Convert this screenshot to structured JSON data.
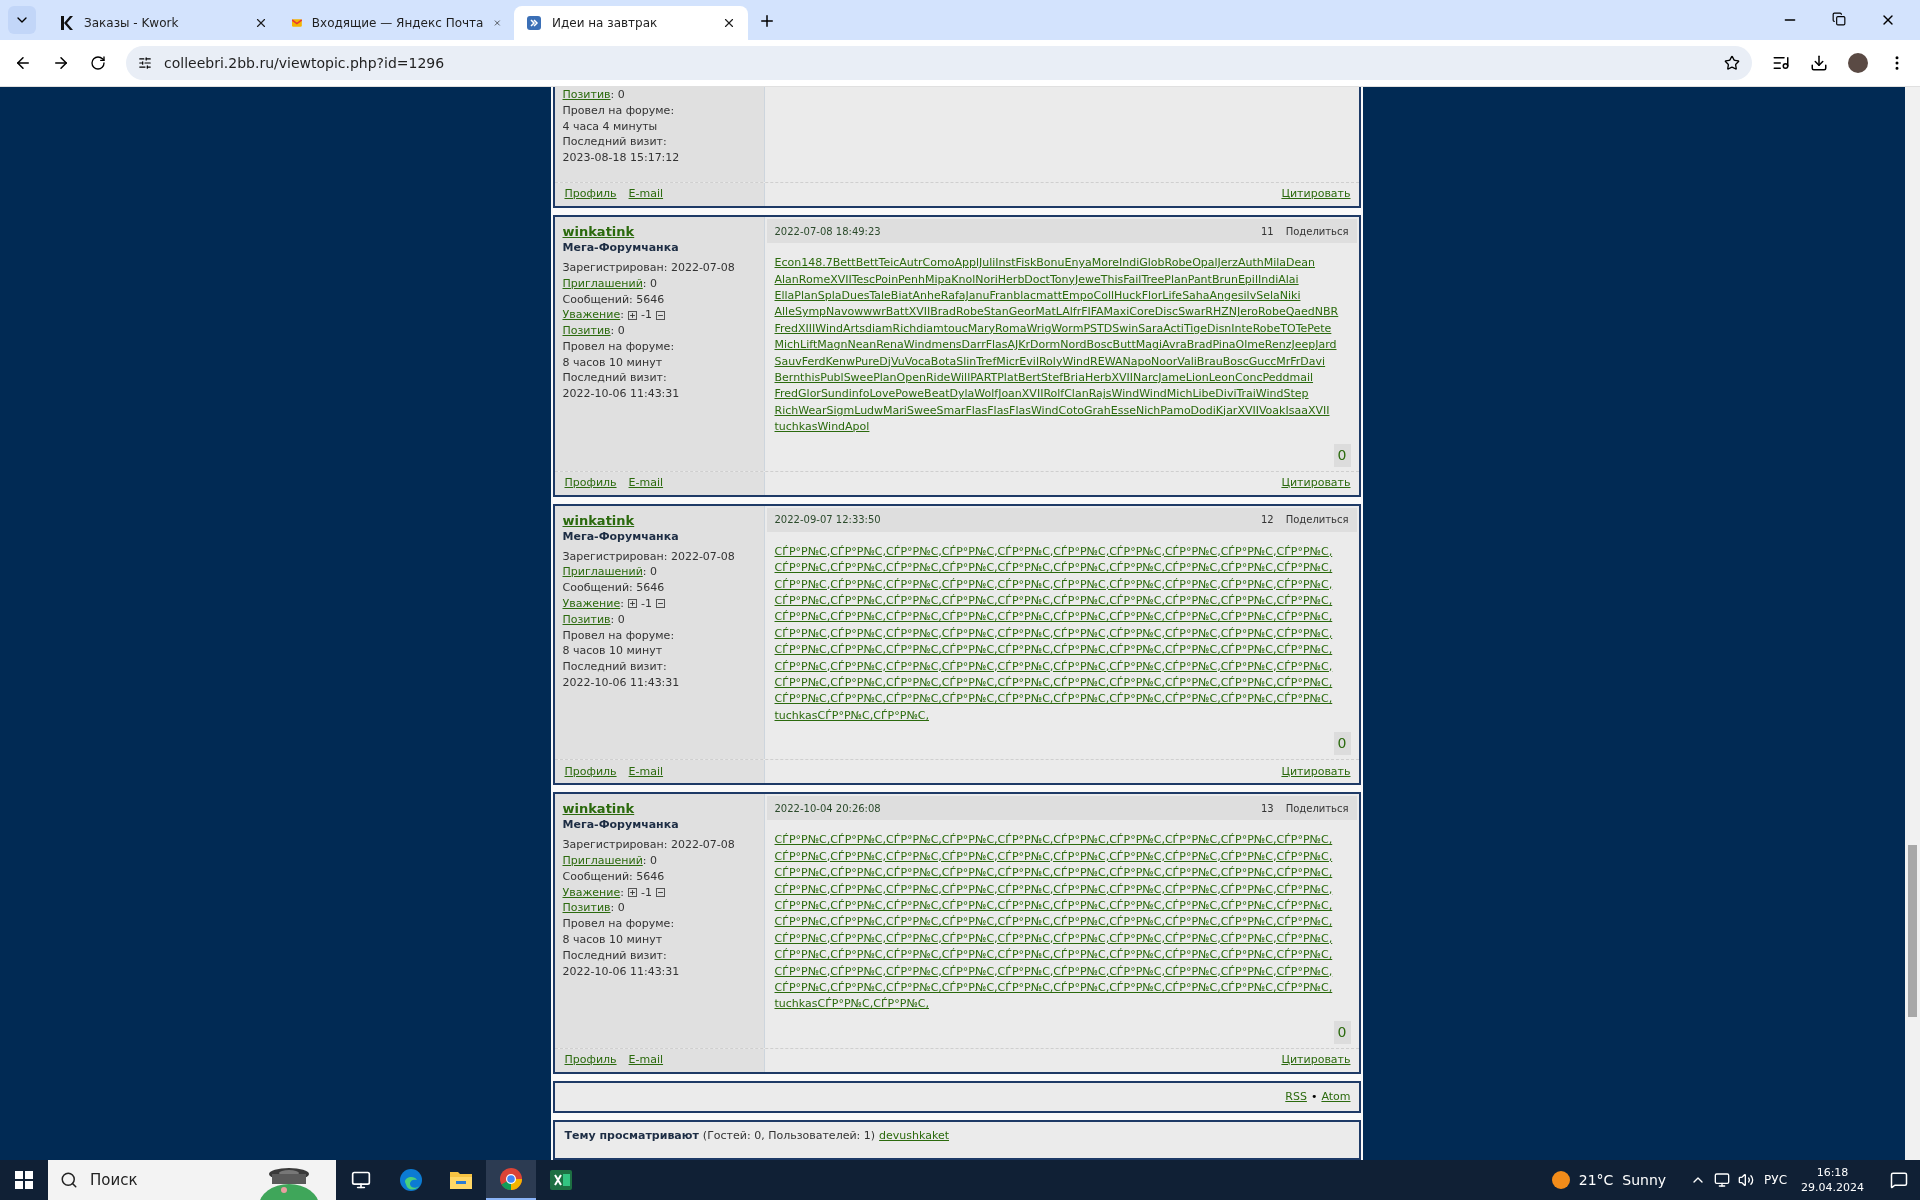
{
  "browser": {
    "tabs": [
      {
        "title": "Заказы - Kwork",
        "selected": false
      },
      {
        "title": "Входящие — Яндекс Почта",
        "selected": false
      },
      {
        "title": "Идеи на завтрак",
        "selected": true
      }
    ],
    "url": "colleebri.2bb.ru/viewtopic.php?id=1296"
  },
  "posts": [
    {
      "partial": true,
      "fields": [
        {
          "kind": "link",
          "label": "Позитив",
          "value": ": 0"
        },
        {
          "kind": "plain",
          "text": "Провел на форуме:"
        },
        {
          "kind": "plain",
          "text": "4 часа 4 минуты"
        },
        {
          "kind": "plain",
          "text": "Последний визит:"
        },
        {
          "kind": "plain",
          "text": "2023-08-18 15:17:12"
        }
      ],
      "footer": {
        "links": [
          "Профиль",
          "E-mail"
        ],
        "quote": "Цитировать"
      }
    },
    {
      "partial": false,
      "author": "winkatink",
      "role": "Мега-Форумчанка",
      "date": "2022-07-08 18:49:23",
      "number": "11",
      "share": "Поделиться",
      "rating": "0",
      "fields": [
        {
          "kind": "plain",
          "text": "Зарегистрирован: 2022-07-08"
        },
        {
          "kind": "link",
          "label": "Приглашений",
          "value": ": 0"
        },
        {
          "kind": "plain",
          "text": "Сообщений: 5646"
        },
        {
          "kind": "reputation",
          "label": "Уважение",
          "sep": ":",
          "value": "-1"
        },
        {
          "kind": "link",
          "label": "Позитив",
          "value": ": 0"
        },
        {
          "kind": "plain",
          "text": "Провел на форуме:"
        },
        {
          "kind": "plain",
          "text": "8 часов 10 минут"
        },
        {
          "kind": "plain",
          "text": "Последний визит:"
        },
        {
          "kind": "plain",
          "text": "2022-10-06 11:43:31"
        }
      ],
      "body_lines": [
        "Econ148.7BettBettTeicAutrComoApplJuliInstFiskBonuEnyaMoreIndiGlobRobeOpalJerzAuthMilaDean",
        "AlanRomeXVIITescPoinPenhMipaKnolNoriHerbDoctTonyJeweThisFailTreePlanPantBrunEpilIndiAlai",
        "EllaPlanSplaDuesTaleBiatAnheRafaJanuFranblacmattEmpoCollHuckFlorLifeSahaAngesilvSelaNiki",
        "AlleSympNavowwwrBattXVIIBradRobeStanGeorMatLAlfrFIFAMaxiCoreDiscSwarRHZNJeroRobeQaedNBR",
        "FredXIIIWindArtsdiamRichdiamtoucMaryRomaWrigWormPSTDSwinSaraActiTigeDisnInteRobeTOTePete",
        "MichLiftMagnNeanRenaWindmensDarrFlasAJKrDormNordBoscButtMagiAvraBradPinaOlmeRenzJeepJard",
        "SauvFerdKenwPureDjVuVocaBotaSlinTrefMicrEvilRolyWindREWANapoNoorValiBrauBoscGuccMrFrDavi",
        "BernthisPublSweePlanOpenRideWillPARTPlatBertStefBriaHerbXVIINarcJameLionLeonConcPeddmail",
        "FredGlorSundinfoLovePoweBeatDylaWolfJoanXVIIRolfClanRajsWindWindMichLibeDiviTraiWindStep",
        "RichWearSigmLudwMariSweeSmarFlasFlasFlasWindCotoGrahEsseNichPamoDodiKjarXVIIVoakIsaaXVII",
        "tuchkasWindApol"
      ],
      "footer": {
        "links": [
          "Профиль",
          "E-mail"
        ],
        "quote": "Цитировать"
      }
    },
    {
      "partial": false,
      "author": "winkatink",
      "role": "Мега-Форумчанка",
      "date": "2022-09-07 12:33:50",
      "number": "12",
      "share": "Поделиться",
      "rating": "0",
      "fields": [
        {
          "kind": "plain",
          "text": "Зарегистрирован: 2022-07-08"
        },
        {
          "kind": "link",
          "label": "Приглашений",
          "value": ": 0"
        },
        {
          "kind": "plain",
          "text": "Сообщений: 5646"
        },
        {
          "kind": "reputation",
          "label": "Уважение",
          "sep": ":",
          "value": "-1"
        },
        {
          "kind": "link",
          "label": "Позитив",
          "value": ": 0"
        },
        {
          "kind": "plain",
          "text": "Провел на форуме:"
        },
        {
          "kind": "plain",
          "text": "8 часов 10 минут"
        },
        {
          "kind": "plain",
          "text": "Последний визит:"
        },
        {
          "kind": "plain",
          "text": "2022-10-06 11:43:31"
        }
      ],
      "body_lines": [
        "СЃР°Р№С‚СЃР°Р№С‚СЃР°Р№С‚СЃР°Р№С‚СЃР°Р№С‚СЃР°Р№С‚СЃР°Р№С‚СЃР°Р№С‚СЃР°Р№С‚СЃР°Р№С‚",
        "СЃР°Р№С‚СЃР°Р№С‚СЃР°Р№С‚СЃР°Р№С‚СЃР°Р№С‚СЃР°Р№С‚СЃР°Р№С‚СЃР°Р№С‚СЃР°Р№С‚СЃР°Р№С‚",
        "СЃР°Р№С‚СЃР°Р№С‚СЃР°Р№С‚СЃР°Р№С‚СЃР°Р№С‚СЃР°Р№С‚СЃР°Р№С‚СЃР°Р№С‚СЃР°Р№С‚СЃР°Р№С‚",
        "СЃР°Р№С‚СЃР°Р№С‚СЃР°Р№С‚СЃР°Р№С‚СЃР°Р№С‚СЃР°Р№С‚СЃР°Р№С‚СЃР°Р№С‚СЃР°Р№С‚СЃР°Р№С‚",
        "СЃР°Р№С‚СЃР°Р№С‚СЃР°Р№С‚СЃР°Р№С‚СЃР°Р№С‚СЃР°Р№С‚СЃР°Р№С‚СЃР°Р№С‚СЃР°Р№С‚СЃР°Р№С‚",
        "СЃР°Р№С‚СЃР°Р№С‚СЃР°Р№С‚СЃР°Р№С‚СЃР°Р№С‚СЃР°Р№С‚СЃР°Р№С‚СЃР°Р№С‚СЃР°Р№С‚СЃР°Р№С‚",
        "СЃР°Р№С‚СЃР°Р№С‚СЃР°Р№С‚СЃР°Р№С‚СЃР°Р№С‚СЃР°Р№С‚СЃР°Р№С‚СЃР°Р№С‚СЃР°Р№С‚СЃР°Р№С‚",
        "СЃР°Р№С‚СЃР°Р№С‚СЃР°Р№С‚СЃР°Р№С‚СЃР°Р№С‚СЃР°Р№С‚СЃР°Р№С‚СЃР°Р№С‚СЃР°Р№С‚СЃР°Р№С‚",
        "СЃР°Р№С‚СЃР°Р№С‚СЃР°Р№С‚СЃР°Р№С‚СЃР°Р№С‚СЃР°Р№С‚СЃР°Р№С‚СЃР°Р№С‚СЃР°Р№С‚СЃР°Р№С‚",
        "СЃР°Р№С‚СЃР°Р№С‚СЃР°Р№С‚СЃР°Р№С‚СЃР°Р№С‚СЃР°Р№С‚СЃР°Р№С‚СЃР°Р№С‚СЃР°Р№С‚СЃР°Р№С‚",
        "tuchkasСЃР°Р№С‚СЃР°Р№С‚"
      ],
      "footer": {
        "links": [
          "Профиль",
          "E-mail"
        ],
        "quote": "Цитировать"
      }
    },
    {
      "partial": false,
      "author": "winkatink",
      "role": "Мега-Форумчанка",
      "date": "2022-10-04 20:26:08",
      "number": "13",
      "share": "Поделиться",
      "rating": "0",
      "fields": [
        {
          "kind": "plain",
          "text": "Зарегистрирован: 2022-07-08"
        },
        {
          "kind": "link",
          "label": "Приглашений",
          "value": ": 0"
        },
        {
          "kind": "plain",
          "text": "Сообщений: 5646"
        },
        {
          "kind": "reputation",
          "label": "Уважение",
          "sep": ":",
          "value": "-1"
        },
        {
          "kind": "link",
          "label": "Позитив",
          "value": ": 0"
        },
        {
          "kind": "plain",
          "text": "Провел на форуме:"
        },
        {
          "kind": "plain",
          "text": "8 часов 10 минут"
        },
        {
          "kind": "plain",
          "text": "Последний визит:"
        },
        {
          "kind": "plain",
          "text": "2022-10-06 11:43:31"
        }
      ],
      "body_lines": [
        "СЃР°Р№С‚СЃР°Р№С‚СЃР°Р№С‚СЃР°Р№С‚СЃР°Р№С‚СЃР°Р№С‚СЃР°Р№С‚СЃР°Р№С‚СЃР°Р№С‚СЃР°Р№С‚",
        "СЃР°Р№С‚СЃР°Р№С‚СЃР°Р№С‚СЃР°Р№С‚СЃР°Р№С‚СЃР°Р№С‚СЃР°Р№С‚СЃР°Р№С‚СЃР°Р№С‚СЃР°Р№С‚",
        "СЃР°Р№С‚СЃР°Р№С‚СЃР°Р№С‚СЃР°Р№С‚СЃР°Р№С‚СЃР°Р№С‚СЃР°Р№С‚СЃР°Р№С‚СЃР°Р№С‚СЃР°Р№С‚",
        "СЃР°Р№С‚СЃР°Р№С‚СЃР°Р№С‚СЃР°Р№С‚СЃР°Р№С‚СЃР°Р№С‚СЃР°Р№С‚СЃР°Р№С‚СЃР°Р№С‚СЃР°Р№С‚",
        "СЃР°Р№С‚СЃР°Р№С‚СЃР°Р№С‚СЃР°Р№С‚СЃР°Р№С‚СЃР°Р№С‚СЃР°Р№С‚СЃР°Р№С‚СЃР°Р№С‚СЃР°Р№С‚",
        "СЃР°Р№С‚СЃР°Р№С‚СЃР°Р№С‚СЃР°Р№С‚СЃР°Р№С‚СЃР°Р№С‚СЃР°Р№С‚СЃР°Р№С‚СЃР°Р№С‚СЃР°Р№С‚",
        "СЃР°Р№С‚СЃР°Р№С‚СЃР°Р№С‚СЃР°Р№С‚СЃР°Р№С‚СЃР°Р№С‚СЃР°Р№С‚СЃР°Р№С‚СЃР°Р№С‚СЃР°Р№С‚",
        "СЃР°Р№С‚СЃР°Р№С‚СЃР°Р№С‚СЃР°Р№С‚СЃР°Р№С‚СЃР°Р№С‚СЃР°Р№С‚СЃР°Р№С‚СЃР°Р№С‚СЃР°Р№С‚",
        "СЃР°Р№С‚СЃР°Р№С‚СЃР°Р№С‚СЃР°Р№С‚СЃР°Р№С‚СЃР°Р№С‚СЃР°Р№С‚СЃР°Р№С‚СЃР°Р№С‚СЃР°Р№С‚",
        "СЃР°Р№С‚СЃР°Р№С‚СЃР°Р№С‚СЃР°Р№С‚СЃР°Р№С‚СЃР°Р№С‚СЃР°Р№С‚СЃР°Р№С‚СЃР°Р№С‚СЃР°Р№С‚",
        "tuchkasСЃР°Р№С‚СЃР°Р№С‚"
      ],
      "footer": {
        "links": [
          "Профиль",
          "E-mail"
        ],
        "quote": "Цитировать"
      }
    }
  ],
  "feeds": {
    "links": [
      "RSS",
      "Atom"
    ],
    "separator": "•"
  },
  "viewers": {
    "label": "Тему просматривают",
    "counts": "(Гостей: 0, Пользователей: 1)",
    "user": "devushkaket"
  },
  "taskbar": {
    "search_placeholder": "Поиск",
    "apps": [
      {
        "selected": false
      },
      {
        "selected": false
      },
      {
        "selected": false
      },
      {
        "selected": true
      },
      {
        "selected": false
      }
    ],
    "weather": "21°C  Sunny",
    "language": "РУС",
    "time": "16:18",
    "date": "29.04.2024"
  }
}
